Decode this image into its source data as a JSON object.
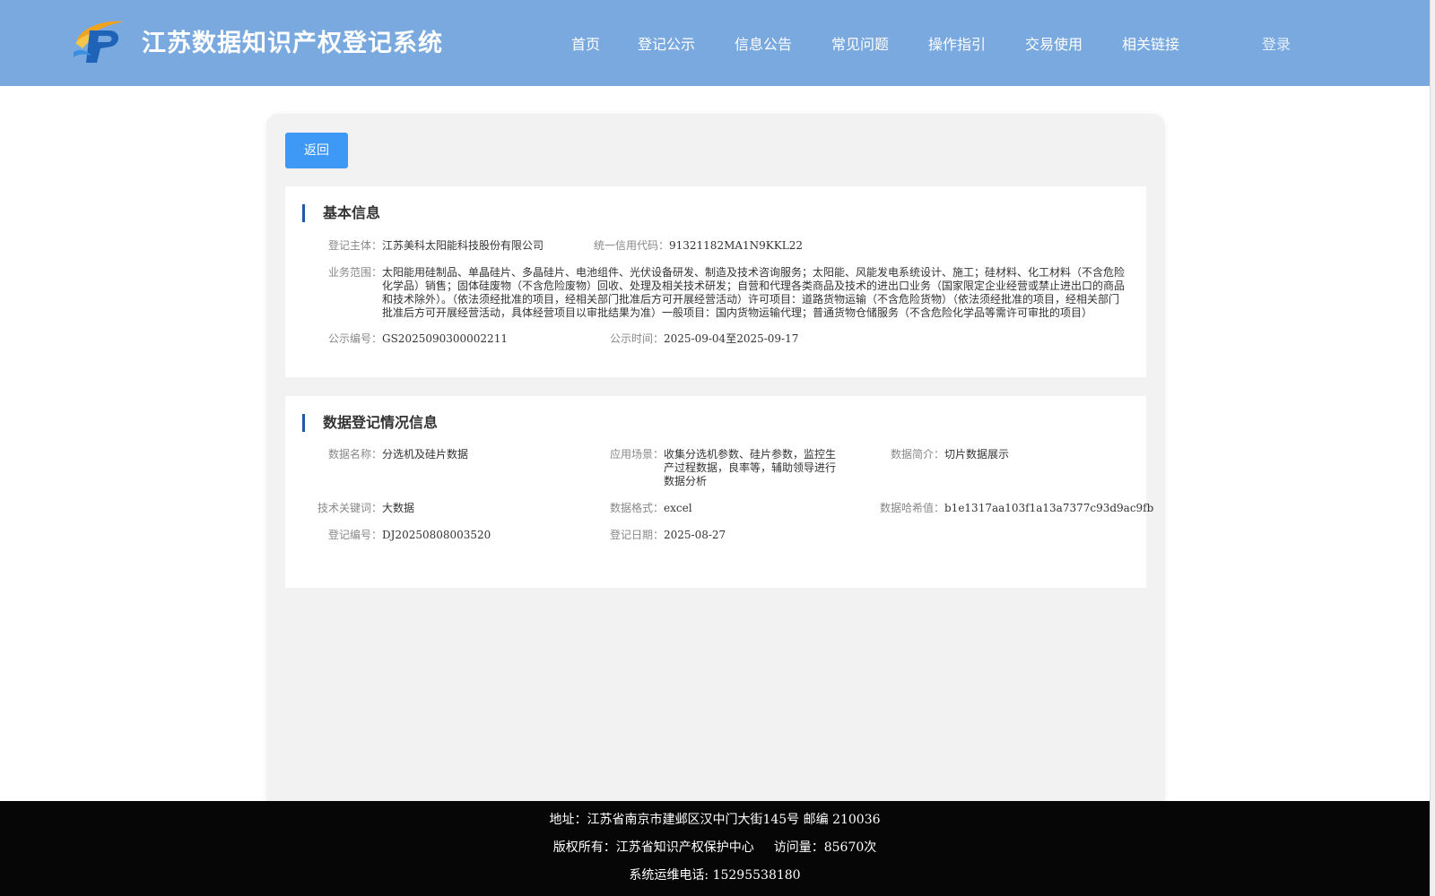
{
  "header": {
    "site_title": "江苏数据知识产权登记系统",
    "nav": [
      "首页",
      "登记公示",
      "信息公告",
      "常见问题",
      "操作指引",
      "交易使用",
      "相关链接"
    ],
    "login_label": "登录"
  },
  "main": {
    "back_label": "返回",
    "basic_info": {
      "title": "基本信息",
      "registrant_label": "登记主体：",
      "registrant_value": "江苏美科太阳能科技股份有限公司",
      "credit_code_label": "统一信用代码：",
      "credit_code_value": "91321182MA1N9KKL22",
      "scope_label": "业务范围：",
      "scope_value": "太阳能用硅制品、单晶硅片、多晶硅片、电池组件、光伏设备研发、制造及技术咨询服务；太阳能、风能发电系统设计、施工；硅材料、化工材料（不含危险化学品）销售；固体硅废物（不含危险废物）回收、处理及相关技术研发；自营和代理各类商品及技术的进出口业务（国家限定企业经营或禁止进出口的商品和技术除外）。（依法须经批准的项目，经相关部门批准后方可开展经营活动）许可项目：道路货物运输（不含危险货物）（依法须经批准的项目，经相关部门批准后方可开展经营活动，具体经营项目以审批结果为准）一般项目：国内货物运输代理；普通货物仓储服务（不含危险化学品等需许可审批的项目）",
      "notice_no_label": "公示编号：",
      "notice_no_value": "GS2025090300002211",
      "notice_time_label": "公示时间：",
      "notice_time_value": "2025-09-04至2025-09-17"
    },
    "data_info": {
      "title": "数据登记情况信息",
      "data_name_label": "数据名称：",
      "data_name_value": "分选机及硅片数据",
      "scenario_label": "应用场景：",
      "scenario_value": "收集分选机参数、硅片参数，监控生产过程数据，良率等，辅助领导进行数据分析",
      "summary_label": "数据简介：",
      "summary_value": "切片数据展示",
      "keyword_label": "技术关键词：",
      "keyword_value": "大数据",
      "format_label": "数据格式：",
      "format_value": "excel",
      "hash_label": "数据哈希值：",
      "hash_value": "b1e1317aa103f1a13a7377c93d9ac9fb",
      "reg_no_label": "登记编号：",
      "reg_no_value": "DJ20250808003520",
      "reg_date_label": "登记日期：",
      "reg_date_value": "2025-08-27"
    }
  },
  "footer": {
    "address": "地址：江苏省南京市建邺区汉中门大街145号 邮编 210036",
    "copyright": "版权所有：江苏省知识产权保护中心",
    "visits": "访问量：85670次",
    "phone": "系统运维电话: 15295538180"
  },
  "colors": {
    "header_bg": "#79a9de",
    "primary_button": "#3d99f5",
    "section_accent": "#1e5aa8",
    "footer_bg": "#060606"
  },
  "icons": [
    "site-logo"
  ]
}
